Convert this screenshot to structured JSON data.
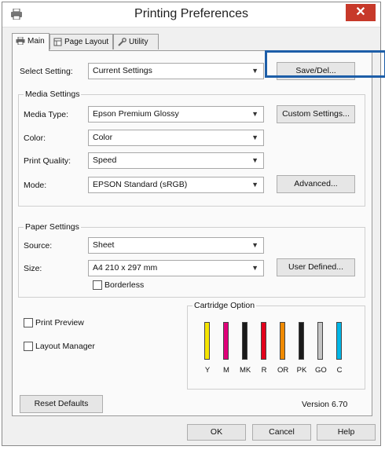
{
  "window": {
    "title": "Printing Preferences"
  },
  "tabs": [
    {
      "label": "Main"
    },
    {
      "label": "Page Layout"
    },
    {
      "label": "Utility"
    }
  ],
  "select_setting": {
    "label": "Select Setting:",
    "value": "Current Settings",
    "button": "Save/Del..."
  },
  "media": {
    "group_title": "Media Settings",
    "type_label": "Media Type:",
    "type_value": "Epson Premium Glossy",
    "custom_button": "Custom Settings...",
    "color_label": "Color:",
    "color_value": "Color",
    "quality_label": "Print Quality:",
    "quality_value": "Speed",
    "mode_label": "Mode:",
    "mode_value": "EPSON Standard (sRGB)",
    "advanced_button": "Advanced..."
  },
  "paper": {
    "group_title": "Paper Settings",
    "source_label": "Source:",
    "source_value": "Sheet",
    "size_label": "Size:",
    "size_value": "A4 210 x 297 mm",
    "user_defined_button": "User Defined...",
    "borderless_label": "Borderless"
  },
  "options": {
    "print_preview": "Print Preview",
    "layout_manager": "Layout Manager"
  },
  "cartridge": {
    "title": "Cartridge Option",
    "inks": [
      {
        "label": "Y",
        "color": "#f5e400"
      },
      {
        "label": "M",
        "color": "#e0007a"
      },
      {
        "label": "MK",
        "color": "#1a1a1a"
      },
      {
        "label": "R",
        "color": "#e3001b"
      },
      {
        "label": "OR",
        "color": "#f08a00"
      },
      {
        "label": "PK",
        "color": "#1a1a1a"
      },
      {
        "label": "GO",
        "color": "#c4c4c4"
      },
      {
        "label": "C",
        "color": "#00b6e6"
      }
    ]
  },
  "footer": {
    "reset_button": "Reset Defaults",
    "version": "Version 6.70"
  },
  "dialog_buttons": {
    "ok": "OK",
    "cancel": "Cancel",
    "help": "Help"
  },
  "colors": {
    "close": "#c7392a",
    "highlight": "#1d5ea8"
  }
}
